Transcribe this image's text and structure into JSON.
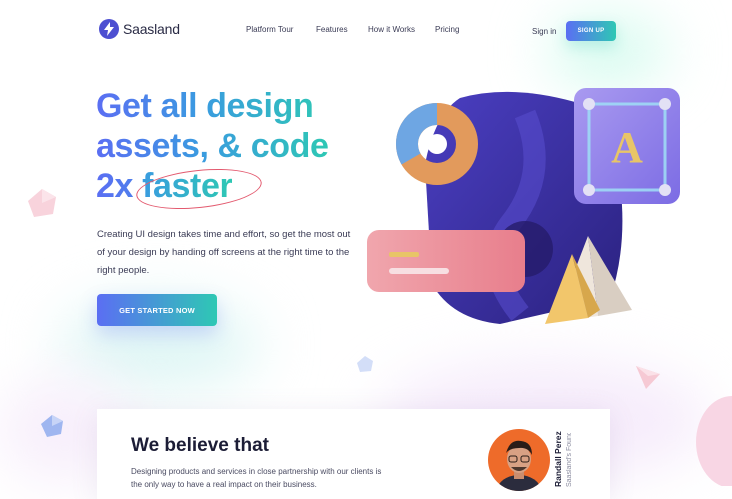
{
  "header": {
    "logo_text": "Saasland",
    "nav": [
      "Platform Tour",
      "Features",
      "How it Works",
      "Pricing"
    ],
    "sign_in": "Sign in",
    "sign_up": "SIGN UP"
  },
  "hero": {
    "line1": "Get all design",
    "line2": "assets, & code",
    "line3_prefix": "2x ",
    "line3_highlight": "faster",
    "subtext": "Creating UI design takes time and effort, so get the most out of your design by handing off screens at the right time to the right people.",
    "cta": "GET STARTED NOW",
    "tile_letter": "A"
  },
  "card": {
    "title": "We believe that",
    "body": "Designing products and services in close partnership with our clients is the only way to have a real impact on their business.",
    "person_name": "Randall Perez",
    "person_role": "Saasland's Founder"
  },
  "colors": {
    "gradient_start": "#5b6ef3",
    "gradient_end": "#2ec8b4",
    "hexagon": "#3b2fa3",
    "highlight_circle": "#e35a6f",
    "avatar_bg": "#ee6b2a"
  }
}
